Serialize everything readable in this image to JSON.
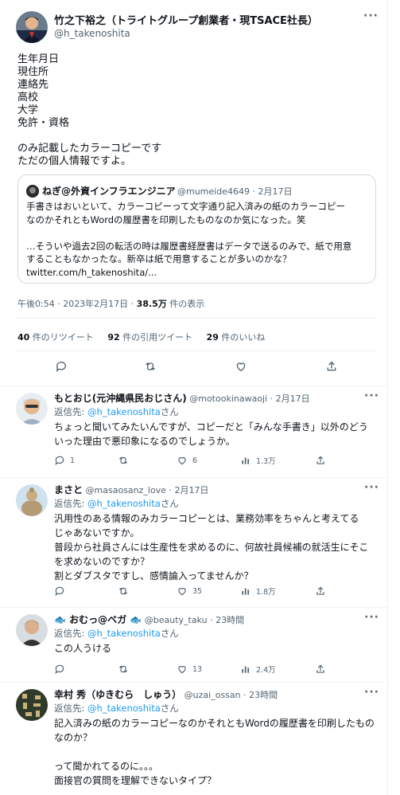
{
  "main_tweet": {
    "author_name": "竹之下裕之（トライトグループ創業者・現TSACE社長）",
    "author_handle": "@h_takenoshita",
    "more_icon": "more-dots-icon",
    "body_lines": [
      "生年月日",
      "現住所",
      "連絡先",
      "高校",
      "大学",
      "免許・資格",
      "",
      "のみ記載したカラーコピーです",
      "ただの個人情報ですよ。"
    ],
    "quote": {
      "author_name": "ねぎ@外資インフラエンジニア",
      "author_meta": "@mumeide4649 · 2月17日",
      "lines": [
        "手書きはおいといて、カラーコピーって文字通り記入済みの紙のカラーコピー",
        "なのかそれともWordの履歴書を印刷したものなのか気になった。笑",
        "",
        "…そういや過去2回の転活の時は履歴書経歴書はデータで送るのみで、紙で用意",
        "することもなかったな。新卒は紙で用意することが多いのかな？",
        "twitter.com/h_takenoshita/..."
      ]
    },
    "timestamp_text": "午後0:54 · 2023年2月17日 · ",
    "views_count": "38.5万",
    "views_label": " 件の表示",
    "retweets_count": "40",
    "retweets_label": " 件のリツイート",
    "quotes_count": "92",
    "quotes_label": " 件の引用ツイート",
    "likes_count": "29",
    "likes_label": " 件のいいね"
  },
  "replies": [
    {
      "name": "もとおじ(元沖縄県民おじさん)",
      "meta": " @motookinawaoji · 2月17日",
      "replying_to_label": "返信先: ",
      "replying_to_handle": "@h_takenoshita",
      "replying_to_suffix": "さん",
      "lines": [
        "ちょっと聞いてみたいんですが、コピーだと「みんな手書き」以外のどう",
        "いった理由で悪印象になるのでしょうか。"
      ],
      "reply_count": "1",
      "retweet_count": "",
      "like_count": "6",
      "view_count": "1.3万"
    },
    {
      "name": "まさと",
      "meta": " @masaosanz_love · 2月17日",
      "replying_to_label": "返信先: ",
      "replying_to_handle": "@h_takenoshita",
      "replying_to_suffix": "さん",
      "lines": [
        "汎用性のある情報のみカラーコピーとは、業務効率をちゃんと考えてる",
        "じゃあないですか。",
        "普段から社員さんには生産性を求めるのに、何故社員候補の就活生にそこ",
        "を求めないのですか？",
        "割とダブスタですし、感情論入ってませんか？"
      ],
      "reply_count": "",
      "retweet_count": "",
      "like_count": "35",
      "view_count": "1.8万"
    },
    {
      "name": "🐟 おむっ@ベガ 🐟",
      "meta": " @beauty_taku · 23時間",
      "replying_to_label": "返信先: ",
      "replying_to_handle": "@h_takenoshita",
      "replying_to_suffix": "さん",
      "lines": [
        "この人うける"
      ],
      "reply_count": "",
      "retweet_count": "",
      "like_count": "13",
      "view_count": "2.4万"
    },
    {
      "name": "幸村 秀（ゆきむら　しゅう）",
      "meta": " @uzai_ossan · 23時間",
      "replying_to_label": "返信先: ",
      "replying_to_handle": "@h_takenoshita",
      "replying_to_suffix": "さん",
      "lines": [
        "記入済みの紙のカラーコピーなのかそれともWordの履歴書を印刷したもの",
        "なのか？",
        "",
        "って聞かれてるのに。。。",
        "面接官の質問を理解できないタイプ？"
      ],
      "reply_count": "",
      "retweet_count": "",
      "like_count": "",
      "view_count": ""
    }
  ],
  "colors": {
    "link": "#1d9bf0",
    "muted": "#536471",
    "text": "#0f1419",
    "border": "#cfd9de"
  }
}
